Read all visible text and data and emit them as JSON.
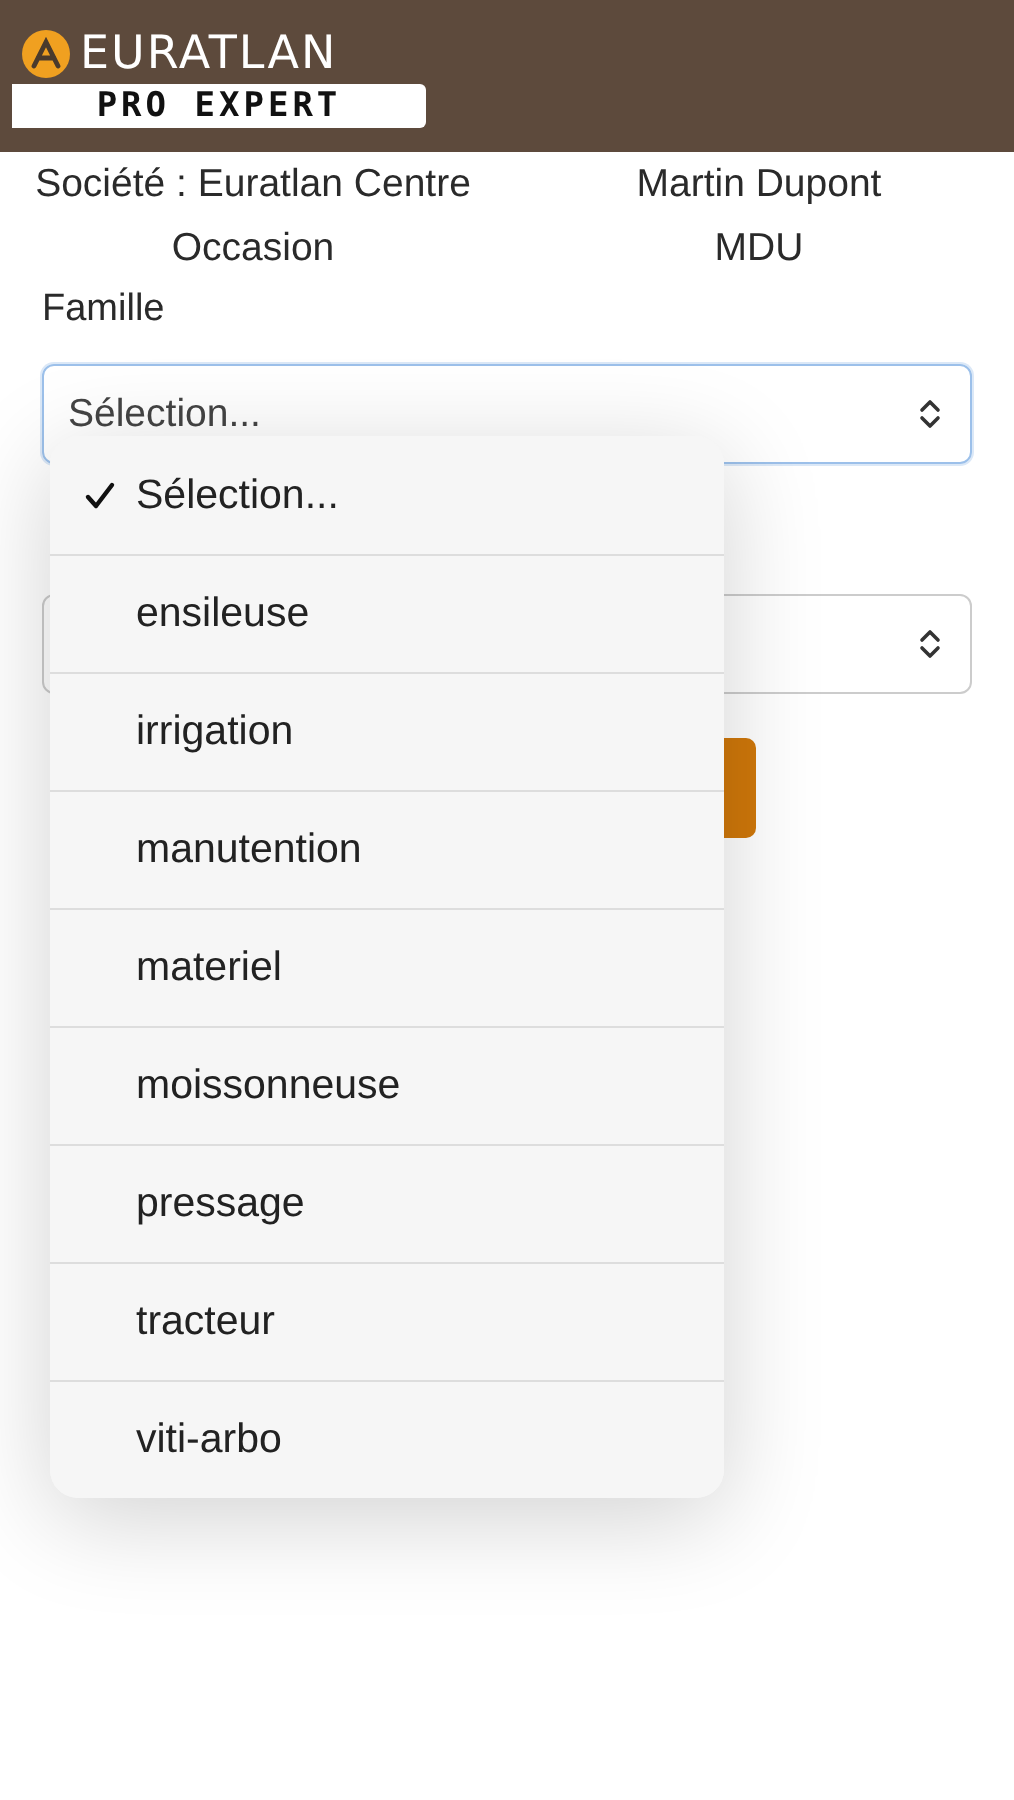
{
  "header": {
    "logo_title": "EURATLAN",
    "logo_subtitle": "PRO EXPERT"
  },
  "info": [
    {
      "left": "Société : Euratlan Centre",
      "right": "Martin Dupont"
    },
    {
      "left": "Occasion",
      "right": "MDU"
    }
  ],
  "famille": {
    "label": "Famille",
    "value": "Sélection...",
    "focused": true
  },
  "dropdown": {
    "options": [
      {
        "label": "Sélection...",
        "selected": true
      },
      {
        "label": "ensileuse",
        "selected": false
      },
      {
        "label": "irrigation",
        "selected": false
      },
      {
        "label": "manutention",
        "selected": false
      },
      {
        "label": "materiel",
        "selected": false
      },
      {
        "label": "moissonneuse",
        "selected": false
      },
      {
        "label": "pressage",
        "selected": false
      },
      {
        "label": "tracteur",
        "selected": false
      },
      {
        "label": "viti-arbo",
        "selected": false
      }
    ]
  }
}
